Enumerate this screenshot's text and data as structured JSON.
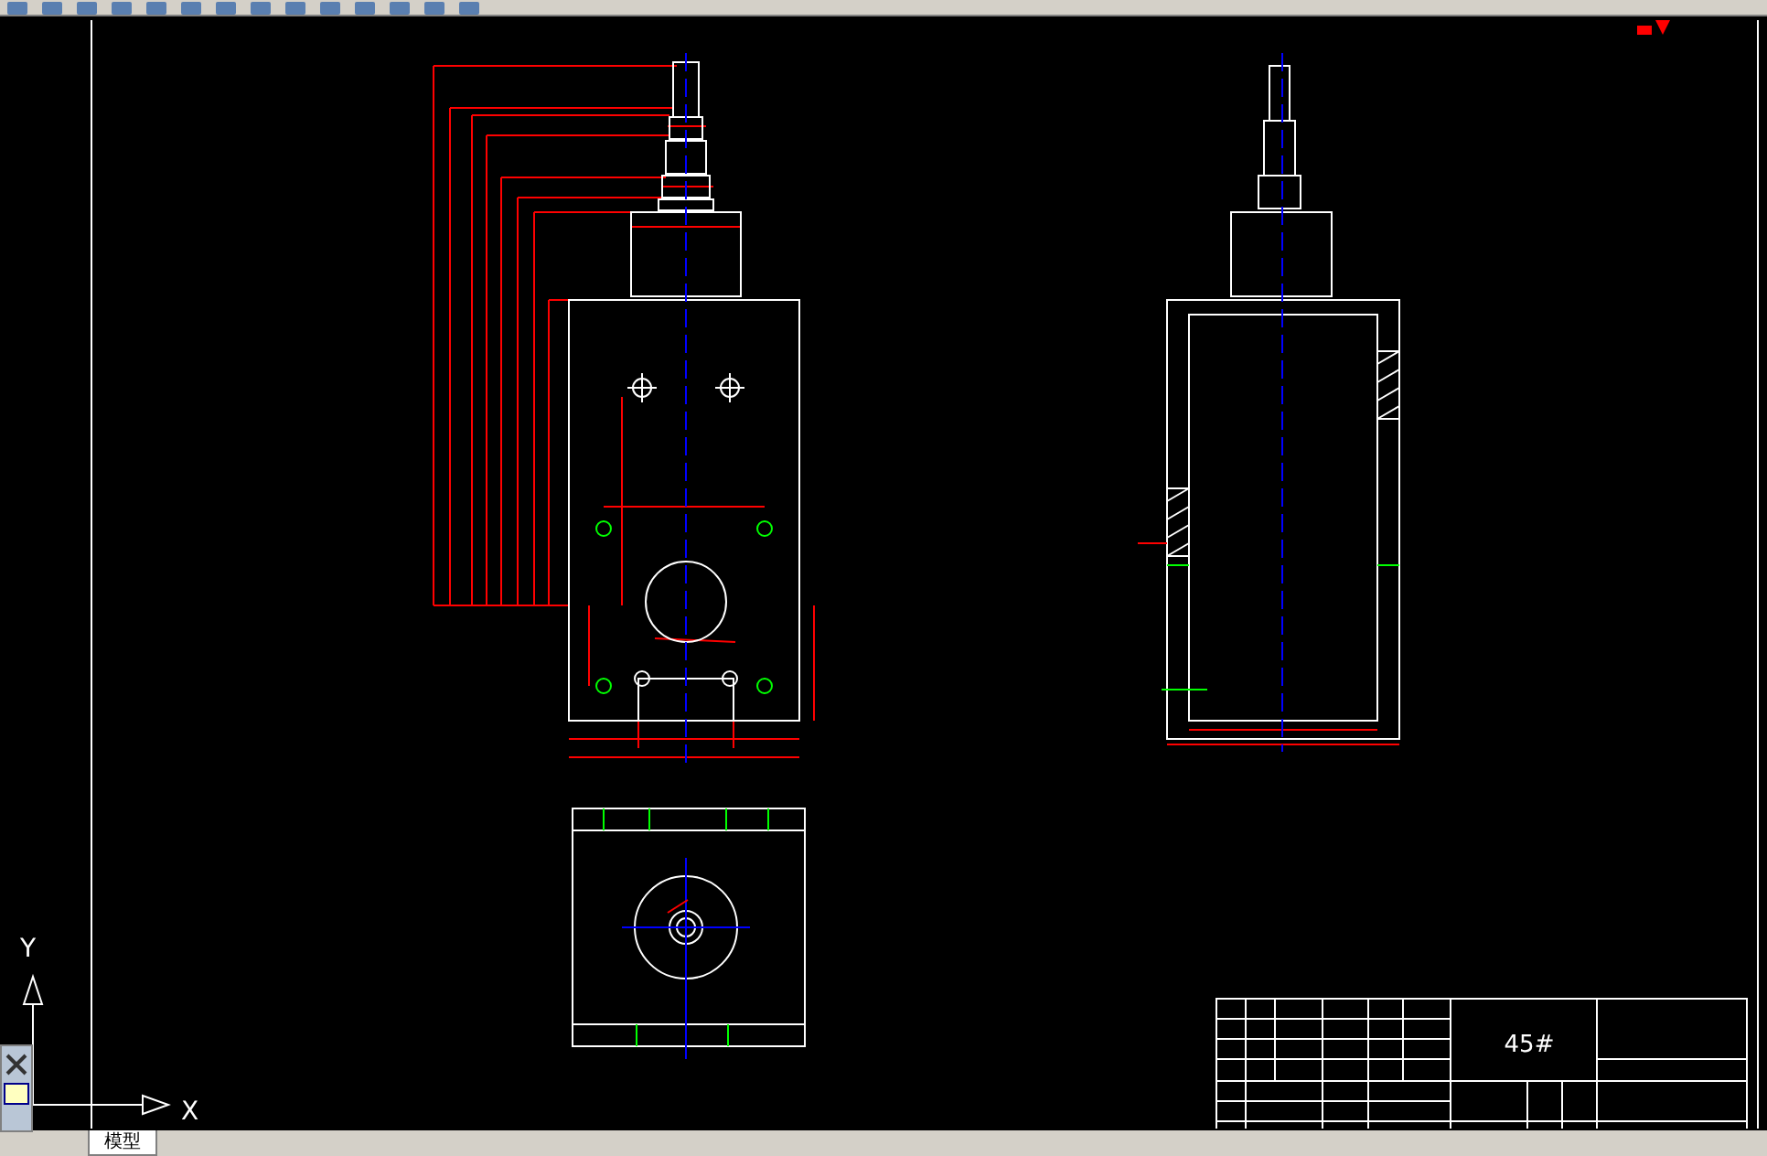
{
  "drawing": {
    "title_block_material": "45#",
    "ucs_y_label": "Y",
    "ucs_x_label": "X"
  },
  "tabs": [
    {
      "label": "模型",
      "selected": true
    }
  ]
}
